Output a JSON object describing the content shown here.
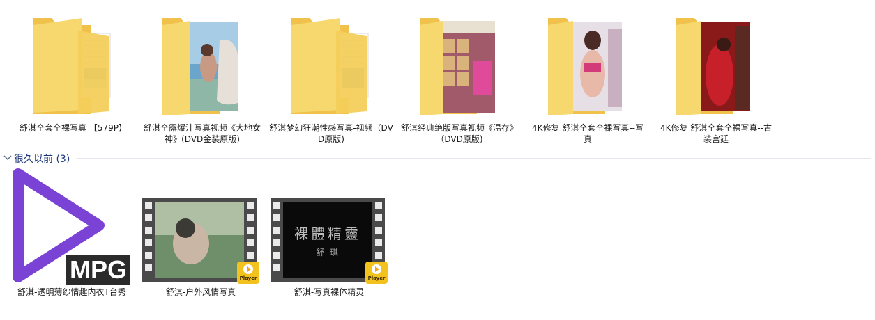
{
  "folders": [
    {
      "label": "舒淇全套全裸写真 【579P】",
      "icon": "folder-icon"
    },
    {
      "label": "舒淇全露爆汁写真视频《大地女神》(DVD金装原版)",
      "icon": "folder-icon"
    },
    {
      "label": "舒淇梦幻狂潮性感写真-视频（DVD原版)",
      "icon": "folder-icon"
    },
    {
      "label": "舒淇经典绝版写真视频《温存》（DVD原版)",
      "icon": "folder-icon"
    },
    {
      "label": "4K修复 舒淇全套全裸写真--写真",
      "icon": "folder-icon"
    },
    {
      "label": "4K修复 舒淇全套全裸写真--古装宫廷",
      "icon": "folder-icon"
    }
  ],
  "group": {
    "label": "很久以前 (3)",
    "collapsed": false
  },
  "videos": [
    {
      "label": "舒淇-透明薄纱情趣内衣T台秀",
      "badge": "MPG",
      "icon": "mpg-play-icon"
    },
    {
      "label": "舒淇-户外风情写真",
      "badge": "Player",
      "icon": "video-thumbnail"
    },
    {
      "label": "舒淇-写真裸体精灵",
      "badge": "Player",
      "icon": "video-thumbnail",
      "title_line1": "裸體精靈",
      "title_line2": "舒 琪"
    }
  ],
  "colors": {
    "folder_back": "#f0c850",
    "folder_front": "#f8dc7c",
    "group_text": "#1f3a7a",
    "mpg_purple": "#7a43d6"
  }
}
